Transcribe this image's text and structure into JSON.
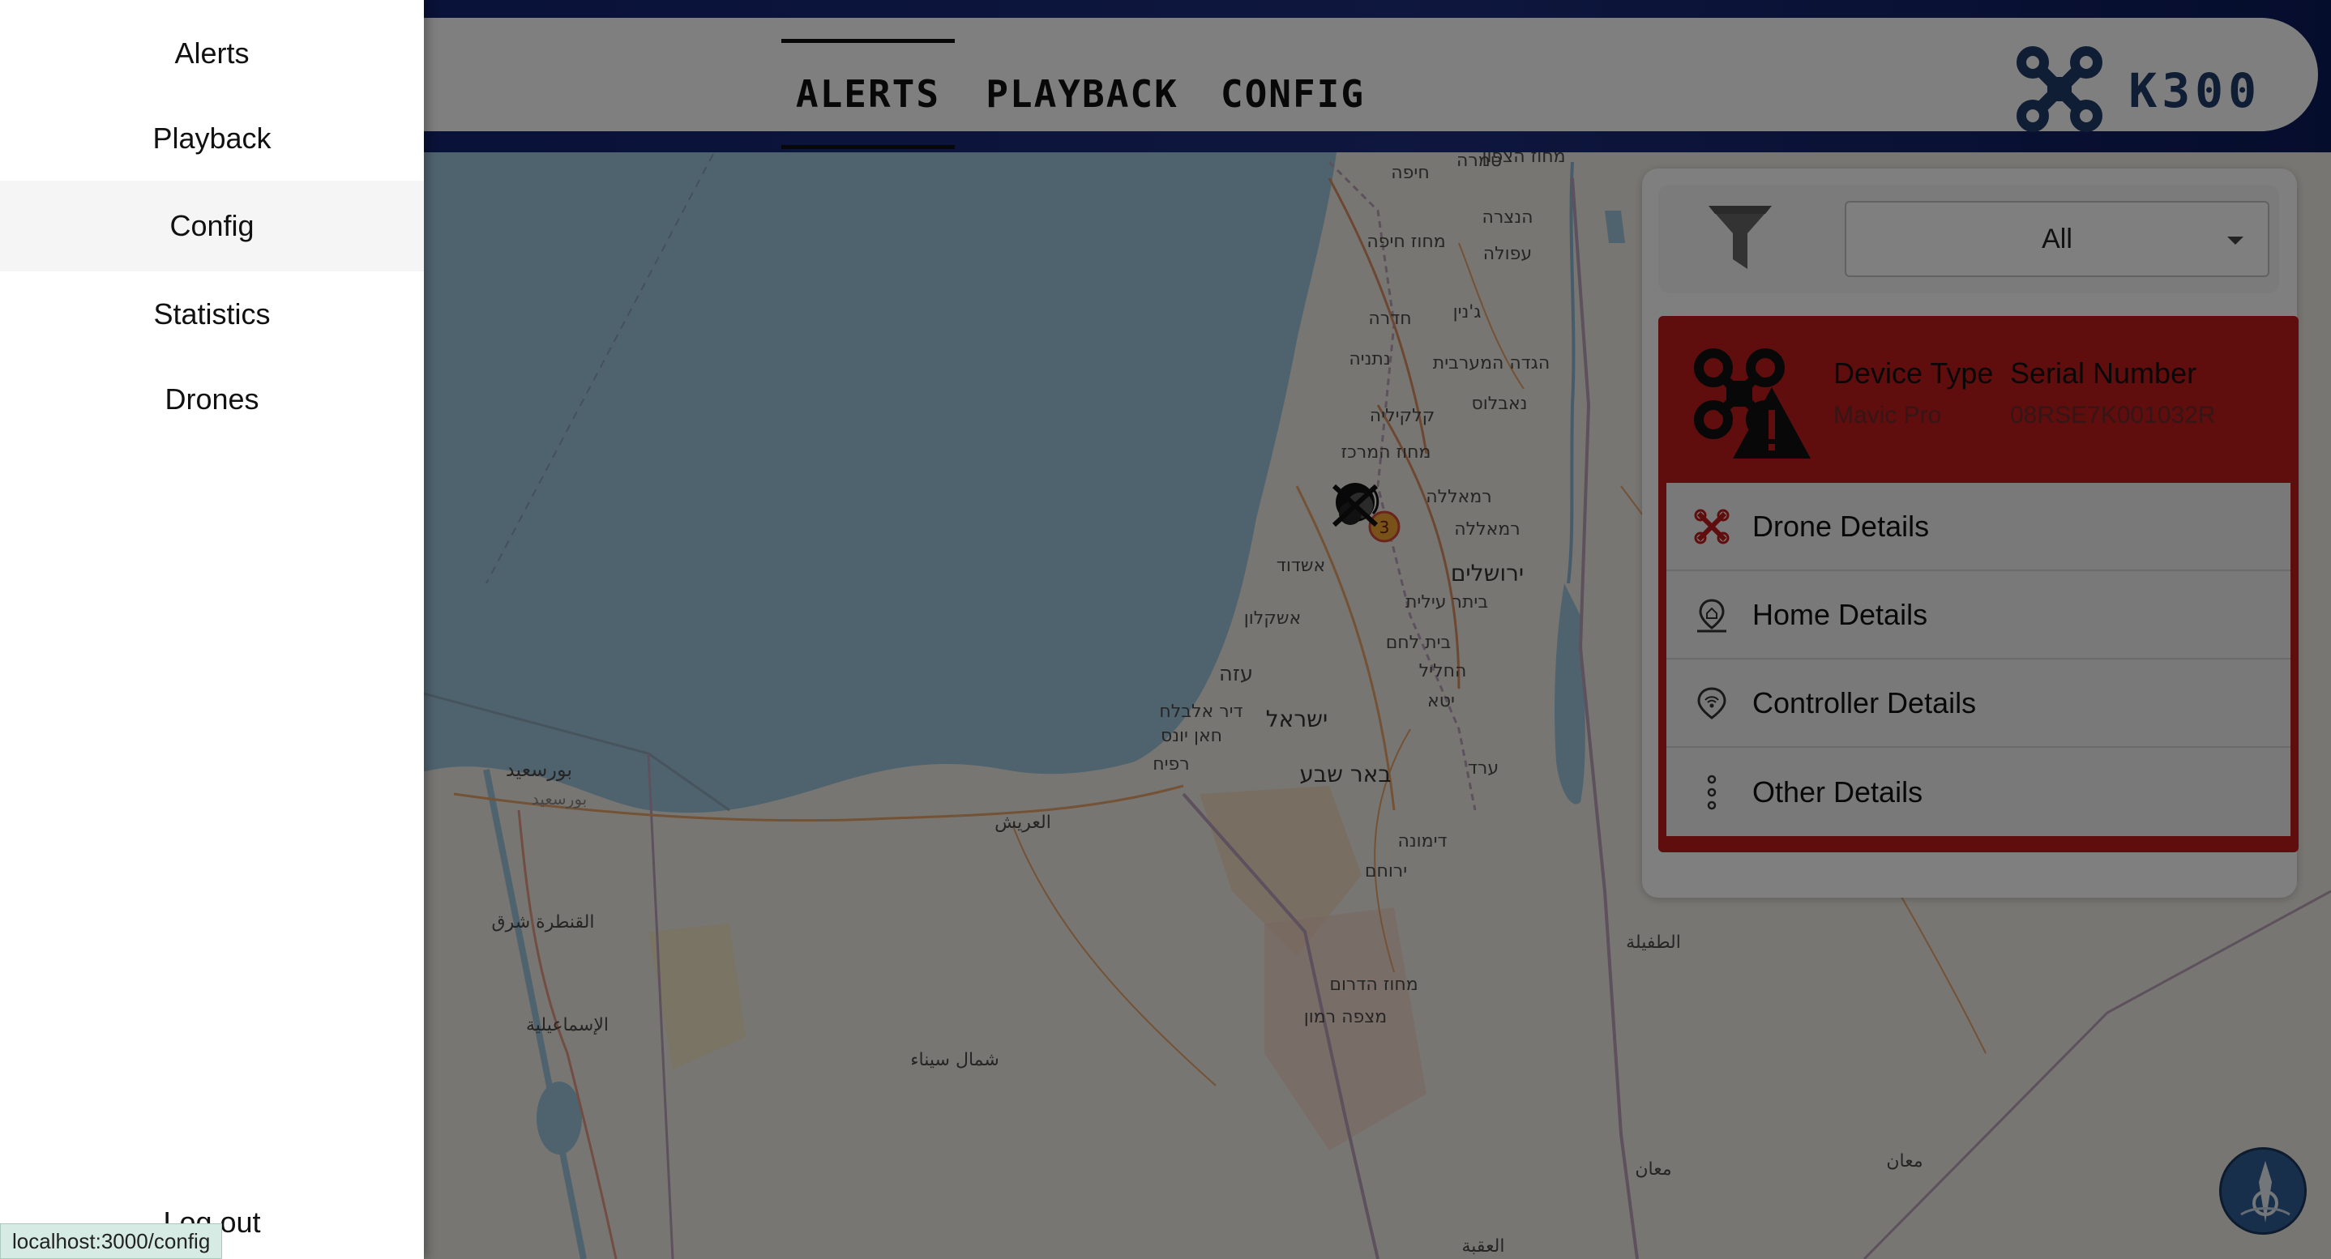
{
  "drawer": {
    "items": [
      {
        "label": "Alerts"
      },
      {
        "label": "Playback"
      },
      {
        "label": "Config"
      },
      {
        "label": "Statistics"
      },
      {
        "label": "Drones"
      }
    ],
    "logout_label": "Log out"
  },
  "statusbar": {
    "url": "localhost:3000/config"
  },
  "header": {
    "tabs": [
      {
        "label": "ALERTS",
        "active": true
      },
      {
        "label": "PLAYBACK",
        "active": false
      },
      {
        "label": "CONFIG",
        "active": false
      }
    ],
    "brand": {
      "text": "K300",
      "icon": "drone-icon"
    }
  },
  "panel": {
    "filter": {
      "icon": "funnel-icon",
      "selected": "All"
    },
    "alert": {
      "icon": "drone-warning-icon",
      "device_type_label": "Device Type",
      "device_type_value": "Mavic Pro",
      "serial_label": "Serial Number",
      "serial_value": "08RSE7K001032R",
      "details": [
        {
          "label": "Drone Details",
          "icon": "drone-x-icon"
        },
        {
          "label": "Home Details",
          "icon": "home-pin-icon"
        },
        {
          "label": "Controller Details",
          "icon": "controller-pin-icon"
        },
        {
          "label": "Other Details",
          "icon": "more-vertical-icon"
        }
      ]
    }
  },
  "map": {
    "marker": {
      "count": "3",
      "icon": "drone-cluster-icon"
    },
    "labels": [
      {
        "text": "מחוז הצפון"
      },
      {
        "text": "חיפה"
      },
      {
        "text": "טמרה"
      },
      {
        "text": "מחוז חיפה"
      },
      {
        "text": "הנצרה"
      },
      {
        "text": "עפולה"
      },
      {
        "text": "חדרה"
      },
      {
        "text": "ג'נין"
      },
      {
        "text": "נתניה"
      },
      {
        "text": "הגדה המערבית"
      },
      {
        "text": "נאבלוס"
      },
      {
        "text": "קלקיליה"
      },
      {
        "text": "מחוז המרכז"
      },
      {
        "text": "רמאללה"
      },
      {
        "text": "רמאללה"
      },
      {
        "text": "אשדוד"
      },
      {
        "text": "ירושלים"
      },
      {
        "text": "ביתר עילית"
      },
      {
        "text": "אשקלון"
      },
      {
        "text": "בית לחם"
      },
      {
        "text": "עזה"
      },
      {
        "text": "החליל"
      },
      {
        "text": "דיר אלבלח"
      },
      {
        "text": "יטא"
      },
      {
        "text": "ישראל"
      },
      {
        "text": "חאן יונס"
      },
      {
        "text": "רפיח"
      },
      {
        "text": "באר שבע"
      },
      {
        "text": "ערד"
      },
      {
        "text": "بورسعيد"
      },
      {
        "text": "بورسعيد"
      },
      {
        "text": "العريش"
      },
      {
        "text": "דימונה"
      },
      {
        "text": "ירוחם"
      },
      {
        "text": "القنطرة شرق"
      },
      {
        "text": "מחוז הדרום"
      },
      {
        "text": "מצפה רמון"
      },
      {
        "text": "الطفيلة"
      },
      {
        "text": "الإسماعيلية"
      },
      {
        "text": "شمال سيناء"
      },
      {
        "text": "معان"
      },
      {
        "text": "معان"
      },
      {
        "text": "العقبة"
      }
    ]
  },
  "colors": {
    "header_band": "#0d1f6b",
    "alert_red": "#c01a1a",
    "brand_blue": "#1f3b6b",
    "sea": "#9ec6df",
    "land": "#f0ece4"
  }
}
